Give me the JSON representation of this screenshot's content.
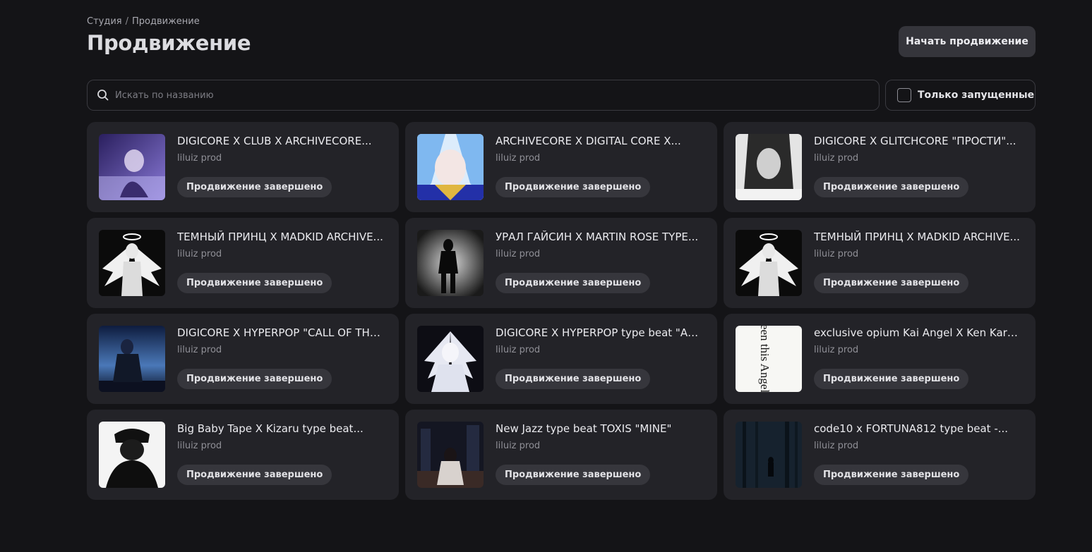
{
  "breadcrumb": {
    "parent": "Студия",
    "separator": "/",
    "current": "Продвижение"
  },
  "page_title": "Продвижение",
  "start_button_label": "Начать продвижение",
  "search": {
    "placeholder": "Искать по названию",
    "value": ""
  },
  "filter": {
    "label": "Только запущенные",
    "checked": false
  },
  "tracks": [
    {
      "title": "DIGICORE X CLUB X ARCHIVECORE...",
      "artist": "liluiz prod",
      "status": "Продвижение завершено",
      "cover_icon": "cover-anime-couple-purple"
    },
    {
      "title": "ARCHIVECORE X DIGITAL CORE X...",
      "artist": "liluiz prod",
      "status": "Продвижение завершено",
      "cover_icon": "cover-anime-blue-hair"
    },
    {
      "title": "DIGICORE X GLITCHCORE \"ПРОСТИ\"...",
      "artist": "liluiz prod",
      "status": "Продвижение завершено",
      "cover_icon": "cover-grey-girl"
    },
    {
      "title": "ТЕМНЫЙ ПРИНЦ X MADKID ARCHIVE...",
      "artist": "liluiz prod",
      "status": "Продвижение завершено",
      "cover_icon": "cover-angel-bw"
    },
    {
      "title": "УРАЛ ГАЙСИН X MARTIN ROSE TYPE...",
      "artist": "liluiz prod",
      "status": "Продвижение завершено",
      "cover_icon": "cover-dark-figure"
    },
    {
      "title": "ТЕМНЫЙ ПРИНЦ X MADKID ARCHIVE...",
      "artist": "liluiz prod",
      "status": "Продвижение завершено",
      "cover_icon": "cover-angel-bw"
    },
    {
      "title": "DIGICORE X HYPERPOP \"CALL OF THE...",
      "artist": "liluiz prod",
      "status": "Продвижение завершено",
      "cover_icon": "cover-night-city-blue"
    },
    {
      "title": "DIGICORE X HYPERPOP type beat \"ALL...",
      "artist": "liluiz prod",
      "status": "Продвижение завершено",
      "cover_icon": "cover-white-angel"
    },
    {
      "title": "exclusive opium Kai Angel X Ken Karson...",
      "artist": "liluiz prod",
      "status": "Продвижение завершено",
      "cover_icon": "cover-text-seen-this-angel",
      "cover_text": "seen this Angel?"
    },
    {
      "title": "Big Baby Tape X Kizaru type beat...",
      "artist": "liluiz prod",
      "status": "Продвижение завершено",
      "cover_icon": "cover-bw-portrait"
    },
    {
      "title": "New Jazz type beat TOXIS \"MINE\"",
      "artist": "liluiz prod",
      "status": "Продвижение завершено",
      "cover_icon": "cover-city-girl-night"
    },
    {
      "title": "code10 x FORTUNA812 type beat -...",
      "artist": "liluiz prod",
      "status": "Продвижение завершено",
      "cover_icon": "cover-dark-forest"
    }
  ]
}
